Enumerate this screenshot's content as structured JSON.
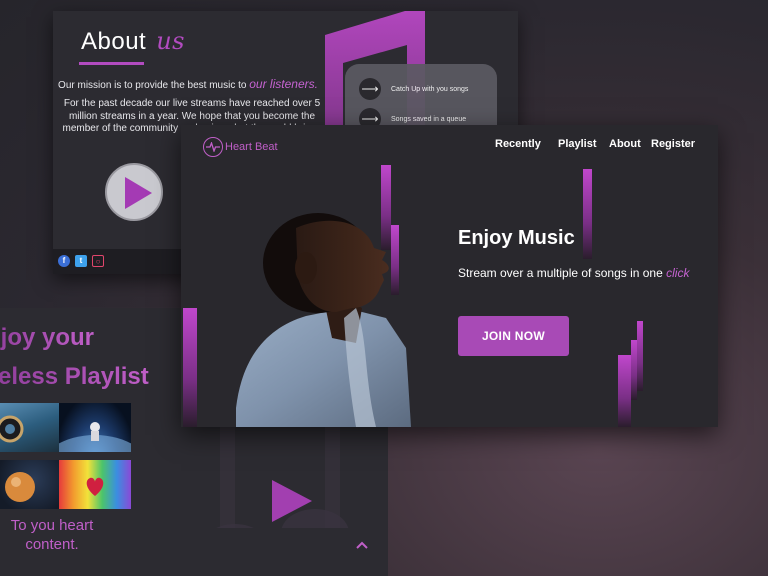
{
  "about": {
    "title_word1": "About",
    "title_word2": "us",
    "mission_prefix": "Our mission is to provide the best music to",
    "mission_highlight": "our listeners.",
    "history": "For the past decade our live streams have reached over 5 million streams in a year. We hope that you become the member of the community and enjoy what the world brings to y",
    "queue_items": [
      {
        "label": "Catch Up with you songs"
      },
      {
        "label": "Songs saved in a queue"
      }
    ],
    "social": [
      "facebook-icon",
      "twitter-icon",
      "instagram-icon"
    ]
  },
  "playlist": {
    "heading_line1": "njoy your",
    "heading_line2": "teless Playlist",
    "caption": "To you heart content."
  },
  "hero": {
    "brand": "Heart Beat",
    "nav": [
      "Recently",
      "Playlist",
      "About",
      "Register"
    ],
    "title": "Enjoy Music",
    "subtitle_prefix": "Stream over a multiple of songs in one",
    "subtitle_highlight": "click",
    "cta": "JOIN NOW"
  },
  "colors": {
    "accent": "#b24bc0",
    "card_bg": "#2c2b31",
    "hero_bg": "#29282d",
    "button": "#a84ab6"
  }
}
